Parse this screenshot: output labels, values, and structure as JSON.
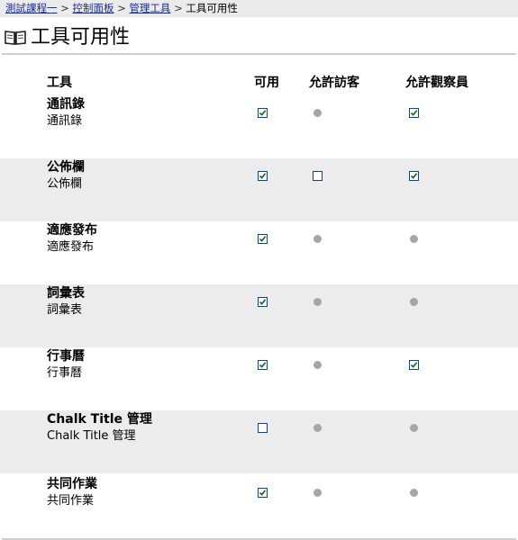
{
  "breadcrumb": {
    "course": "測試課程一",
    "control_panel": "控制面板",
    "manage_tools": "管理工具",
    "current": "工具可用性",
    "separator": ">"
  },
  "page": {
    "title": "工具可用性",
    "icon": "book-icon"
  },
  "columns": {
    "tool": "工具",
    "available": "可用",
    "allow_guests": "允許訪客",
    "allow_observers": "允許觀察員"
  },
  "tools": [
    {
      "name": "通訊錄",
      "description": "通訊錄",
      "available": true,
      "guests": null,
      "observers": true
    },
    {
      "name": "公佈欄",
      "description": "公佈欄",
      "available": true,
      "guests": false,
      "observers": true
    },
    {
      "name": "適應發布",
      "description": "適應發布",
      "available": true,
      "guests": null,
      "observers": null
    },
    {
      "name": "詞彙表",
      "description": "詞彙表",
      "available": true,
      "guests": null,
      "observers": null
    },
    {
      "name": "行事曆",
      "description": "行事曆",
      "available": true,
      "guests": null,
      "observers": true
    },
    {
      "name": "Chalk Title 管理",
      "description": "Chalk Title 管理",
      "available": false,
      "guests": null,
      "observers": null
    },
    {
      "name": "共同作業",
      "description": "共同作業",
      "available": true,
      "guests": null,
      "observers": null
    }
  ],
  "colors": {
    "link": "#1a2b8c",
    "shaded_row": "#ececec",
    "checkbox_border": "#1f3f7a",
    "checkmark": "#1e6b2a",
    "disabled_dot": "#a6a6a6"
  }
}
